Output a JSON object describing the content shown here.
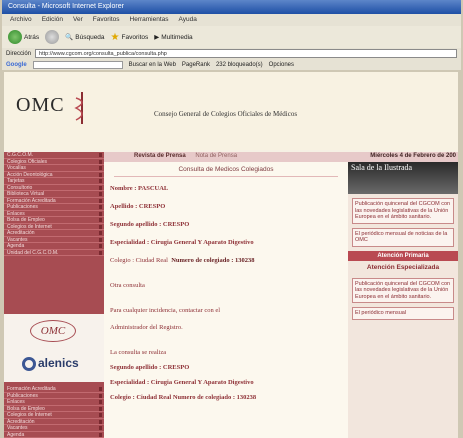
{
  "window": {
    "title": "Consulta - Microsoft Internet Explorer"
  },
  "menu": [
    "Archivo",
    "Edición",
    "Ver",
    "Favoritos",
    "Herramientas",
    "Ayuda"
  ],
  "toolbar": {
    "back": "Atrás",
    "search": "Búsqueda",
    "favorites": "Favoritos",
    "multimedia": "Multimedia"
  },
  "address": {
    "label": "Dirección",
    "url": "http://www.cgcom.org/consulta_publica/consulta.php"
  },
  "google": {
    "logo": "Google",
    "search_web": "Buscar en la Web",
    "pagerank": "PageRank",
    "blocked": "232 bloqueado(s)",
    "options": "Opciones"
  },
  "site": {
    "logo": "OMC",
    "council": "Consejo General de Colegios Oficiales de Médicos",
    "press": "Revista de Prensa",
    "news": "Nota de Prensa",
    "date": "Miércoles 4 de Febrero de 200"
  },
  "nav1": [
    "C.G.C.O.M.",
    "Colegios Oficiales",
    "Vocalías",
    "Acción Deontológica",
    "Tarjetas",
    "Consultorio",
    "Biblioteca Virtual",
    "Formación Acreditada",
    "Publicaciones",
    "Enlaces",
    "Bolsa de Empleo",
    "Colegios de Internet",
    "Acreditación",
    "Vacantes",
    "Agenda",
    "Unidad del C.G.C.O.M."
  ],
  "logos": {
    "omc": "OMC",
    "galenics": "alenics"
  },
  "nav2": [
    "Formación Acreditada",
    "Publicaciones",
    "Enlaces",
    "Bolsa de Empleo",
    "Colegios de Internet",
    "Acreditación",
    "Vacantes",
    "Agenda"
  ],
  "consult": {
    "title": "Consulta de Medicos Colegiados",
    "nombre": "Nombre : PASCUAL",
    "apellido1": "Apellido : CRESPO",
    "apellido2": "Segundo apellido : CRESPO",
    "especialidad": "Especialidad : Cirugia General Y Aparato Digestivo",
    "colegio": "Colegio : Ciudad Real",
    "numero": "Numero de colegiado : 130238",
    "otra": "Otra consulta",
    "incid1": "Para cualquier incidencia, contactar con el",
    "incid2": "Administrador del Registro.",
    "realiza": "La consulta se realiza",
    "apellido2b": "Segundo apellido : CRESPO",
    "especialidad2": "Especialidad : Cirugia General Y Aparato Digestivo",
    "colegio2": "Colegio : Ciudad Real   Numero de colegiado : 130238"
  },
  "right": {
    "banner": "Sala de la Ilustrada",
    "box1": "Publicación quincenal del CGCOM con las novedades legislativas de la Unión Europea en el ámbito sanitario.",
    "box2": "El periódico mensual de noticias de la OMC",
    "atencion": "Atención Primaria",
    "especializada": "Atención Especializada",
    "box3": "Publicación quincenal del CGCOM con las novedades legislativas de la Unión Europea en el ámbito sanitario.",
    "box4": "El periódico mensual"
  }
}
